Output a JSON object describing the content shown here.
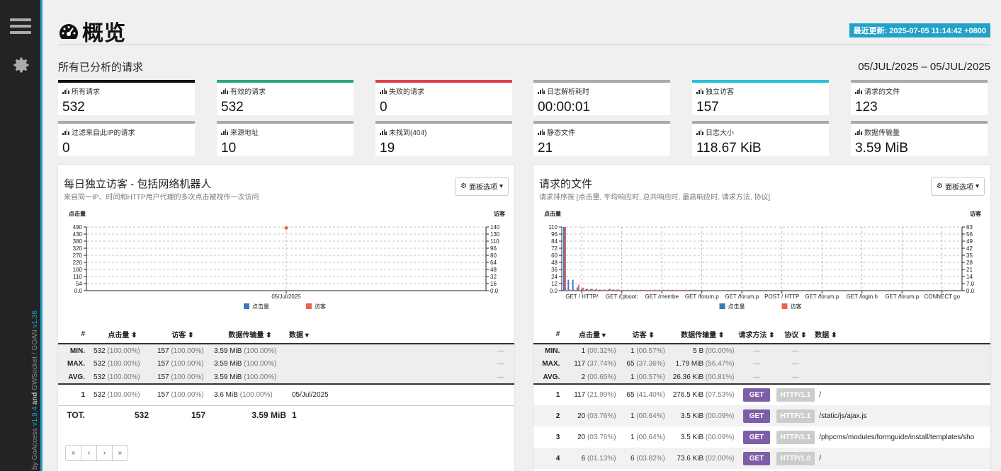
{
  "sidebar": {
    "credit_prefix": "by GoAccess ",
    "goaccess_version": "v1.9.4",
    "and": " and ",
    "gwsocket": "GWSocket / GOAN ",
    "gwsocket_version": "v1.36"
  },
  "header": {
    "title": "概览",
    "last_updated": "最近更新: 2025-07-05 11:14:42 +0800"
  },
  "overall": {
    "title": "所有已分析的请求",
    "date_range": "05/JUL/2025 – 05/JUL/2025",
    "stats": [
      {
        "label": "所有请求",
        "value": "532",
        "color": "#111111"
      },
      {
        "label": "有效的请求",
        "value": "532",
        "color": "#2ea67c"
      },
      {
        "label": "失败的请求",
        "value": "0",
        "color": "#e0404a"
      },
      {
        "label": "日志解析耗时",
        "value": "00:00:01",
        "color": "#aaaaaa"
      },
      {
        "label": "独立访客",
        "value": "157",
        "color": "#22c3d8"
      },
      {
        "label": "请求的文件",
        "value": "123",
        "color": "#aaaaaa"
      },
      {
        "label": "过滤来自此IP的请求",
        "value": "0",
        "color": "#aaaaaa"
      },
      {
        "label": "来源地址",
        "value": "10",
        "color": "#aaaaaa"
      },
      {
        "label": "未找到(404)",
        "value": "19",
        "color": "#aaaaaa"
      },
      {
        "label": "静态文件",
        "value": "21",
        "color": "#aaaaaa"
      },
      {
        "label": "日志大小",
        "value": "118.67 KiB",
        "color": "#aaaaaa"
      },
      {
        "label": "数据传输量",
        "value": "3.59 MiB",
        "color": "#aaaaaa"
      }
    ]
  },
  "visitors": {
    "title": "每日独立访客 - 包括网络机器人",
    "subtitle": "来自同一IP、时间和HTTP用户代理的多次点击被视作一次访问",
    "options": "面板选项",
    "columns": [
      "#",
      "点击量 ⬍",
      "访客 ⬍",
      "数据传输量 ⬍",
      "数据 ▾"
    ],
    "summary": [
      {
        "label": "MIN.",
        "hits": "532",
        "hits_pct": "(100.00%)",
        "visitors": "157",
        "visitors_pct": "(100.00%)",
        "bw": "3.59 MiB",
        "bw_pct": "(100.00%)",
        "data": "—"
      },
      {
        "label": "MAX.",
        "hits": "532",
        "hits_pct": "(100.00%)",
        "visitors": "157",
        "visitors_pct": "(100.00%)",
        "bw": "3.59 MiB",
        "bw_pct": "(100.00%)",
        "data": "—"
      },
      {
        "label": "AVG.",
        "hits": "532",
        "hits_pct": "(100.00%)",
        "visitors": "157",
        "visitors_pct": "(100.00%)",
        "bw": "3.59 MiB",
        "bw_pct": "(100.00%)",
        "data": "—"
      }
    ],
    "rows": [
      {
        "n": "1",
        "hits": "532",
        "hits_pct": "(100.00%)",
        "visitors": "157",
        "visitors_pct": "(100.00%)",
        "bw": "3.6 MiB",
        "bw_pct": "(100.00%)",
        "data": "05/Jul/2025"
      }
    ],
    "total": {
      "label": "TOT.",
      "hits": "532",
      "visitors": "157",
      "bw": "3.59 MiB",
      "data": "1"
    },
    "pager": [
      "«",
      "‹",
      "›",
      "»"
    ]
  },
  "files": {
    "title": "请求的文件",
    "subtitle": "请求排序按 [点击量, 平均响应时, 总共响应时, 最高响应时, 请求方法, 协议]",
    "options": "面板选项",
    "columns": [
      "#",
      "点击量 ▾",
      "访客 ⬍",
      "数据传输量 ⬍",
      "请求方法 ⬍",
      "协议 ⬍",
      "数据 ⬍"
    ],
    "summary": [
      {
        "label": "MIN.",
        "hits": "1",
        "hits_pct": "(00.32%)",
        "visitors": "1",
        "visitors_pct": "(00.57%)",
        "bw": "5 B",
        "bw_pct": "(00.00%)",
        "method": "—",
        "proto": "—"
      },
      {
        "label": "MAX.",
        "hits": "117",
        "hits_pct": "(37.74%)",
        "visitors": "65",
        "visitors_pct": "(37.36%)",
        "bw": "1.79 MiB",
        "bw_pct": "(56.47%)",
        "method": "—",
        "proto": "—"
      },
      {
        "label": "AVG.",
        "hits": "2",
        "hits_pct": "(00.65%)",
        "visitors": "1",
        "visitors_pct": "(00.57%)",
        "bw": "26.36 KiB",
        "bw_pct": "(00.81%)",
        "method": "—",
        "proto": "—"
      }
    ],
    "rows": [
      {
        "n": "1",
        "hits": "117",
        "hits_pct": "(21.99%)",
        "visitors": "65",
        "visitors_pct": "(41.40%)",
        "bw": "276.5 KiB",
        "bw_pct": "(07.53%)",
        "method": "GET",
        "proto": "HTTP/1.1",
        "data": "/"
      },
      {
        "n": "2",
        "hits": "20",
        "hits_pct": "(03.76%)",
        "visitors": "1",
        "visitors_pct": "(00.64%)",
        "bw": "3.5 KiB",
        "bw_pct": "(00.09%)",
        "method": "GET",
        "proto": "HTTP/1.1",
        "data": "/static/js/ajax.js"
      },
      {
        "n": "3",
        "hits": "20",
        "hits_pct": "(03.76%)",
        "visitors": "1",
        "visitors_pct": "(00.64%)",
        "bw": "3.5 KiB",
        "bw_pct": "(00.09%)",
        "method": "GET",
        "proto": "HTTP/1.1",
        "data": "/phpcms/modules/formguide/install/templates/sho"
      },
      {
        "n": "4",
        "hits": "6",
        "hits_pct": "(01.13%)",
        "visitors": "6",
        "visitors_pct": "(03.82%)",
        "bw": "73.6 KiB",
        "bw_pct": "(02.00%)",
        "method": "GET",
        "proto": "HTTP/1.0",
        "data": "/"
      }
    ]
  },
  "chart_data": [
    {
      "type": "bar",
      "ylabel_left": "点击量",
      "ylabel_right": "访客",
      "left_ticks": [
        "490",
        "430",
        "380",
        "320",
        "270",
        "220",
        "160",
        "110",
        "54",
        "0.0"
      ],
      "right_ticks": [
        "140",
        "130",
        "110",
        "96",
        "80",
        "64",
        "48",
        "32",
        "16",
        "0.0"
      ],
      "categories": [
        "05/Jul/2025"
      ],
      "series": [
        {
          "name": "点击量",
          "values": [
            532
          ],
          "color": "#3a7bc0"
        },
        {
          "name": "访客",
          "values": [
            157
          ],
          "color": "#f06050"
        }
      ],
      "ylim_left": [
        0,
        540
      ],
      "ylim_right": [
        0,
        157
      ]
    },
    {
      "type": "bar",
      "ylabel_left": "点击量",
      "ylabel_right": "访客",
      "left_ticks": [
        "110",
        "96",
        "84",
        "72",
        "60",
        "48",
        "36",
        "24",
        "12",
        "0.0"
      ],
      "right_ticks": [
        "63",
        "56",
        "49",
        "42",
        "35",
        "28",
        "21",
        "14",
        "7.0",
        "0.0"
      ],
      "categories": [
        "GET / HTTP/",
        "GET /(pboot:",
        "GET /membe",
        "GET /forum.p",
        "GET /forum.p",
        "POST / HTTP",
        "GET /forum.p",
        "GET /login.h",
        "GET /forum.p",
        "CONNECT go"
      ],
      "series": [
        {
          "name": "点击量",
          "values": [
            117,
            20,
            20,
            6,
            4,
            3,
            3,
            2,
            2,
            2,
            2,
            2,
            2,
            1,
            1,
            1,
            1,
            1,
            1,
            1,
            1,
            1,
            1,
            1,
            1,
            1,
            1,
            1,
            1,
            1
          ],
          "color": "#3a7bc0"
        },
        {
          "name": "访客",
          "values": [
            65,
            1,
            1,
            6,
            3,
            2,
            2,
            2,
            1,
            1,
            2,
            1,
            1,
            1,
            1,
            1,
            1,
            1,
            1,
            1,
            1,
            1,
            1,
            1,
            1,
            1,
            1,
            1,
            1,
            1
          ],
          "color": "#f06050"
        }
      ],
      "ylim_left": [
        0,
        117
      ],
      "ylim_right": [
        0,
        65
      ]
    }
  ]
}
